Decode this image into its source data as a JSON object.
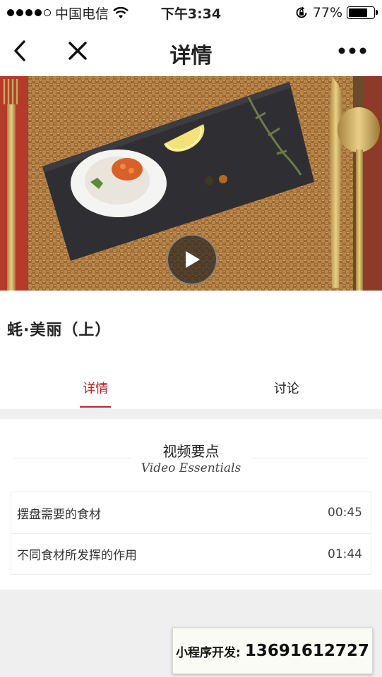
{
  "status_bar": {
    "carrier": "中国电信",
    "time": "下午3:34",
    "battery_percent": "77%",
    "battery_level": 0.77,
    "signal_bars_filled": 4,
    "signal_bars_total": 5
  },
  "nav": {
    "title": "详情",
    "back_icon": "chevron-left-icon",
    "close_icon": "close-icon",
    "more_icon": "more-icon"
  },
  "video": {
    "title": "蚝·美丽（上）",
    "play_icon": "play-icon"
  },
  "tabs": [
    {
      "label": "详情",
      "active": true
    },
    {
      "label": "讨论",
      "active": false
    }
  ],
  "essentials": {
    "title": "视频要点",
    "subtitle": "Video Essentials",
    "items": [
      {
        "label": "摆盘需要的食材",
        "time": "00:45"
      },
      {
        "label": "不同食材所发挥的作用",
        "time": "01:44"
      }
    ]
  },
  "promo": {
    "label": "小程序开发:",
    "phone": "13691612727"
  },
  "colors": {
    "accent": "#c0242a",
    "background": "#efefef"
  }
}
